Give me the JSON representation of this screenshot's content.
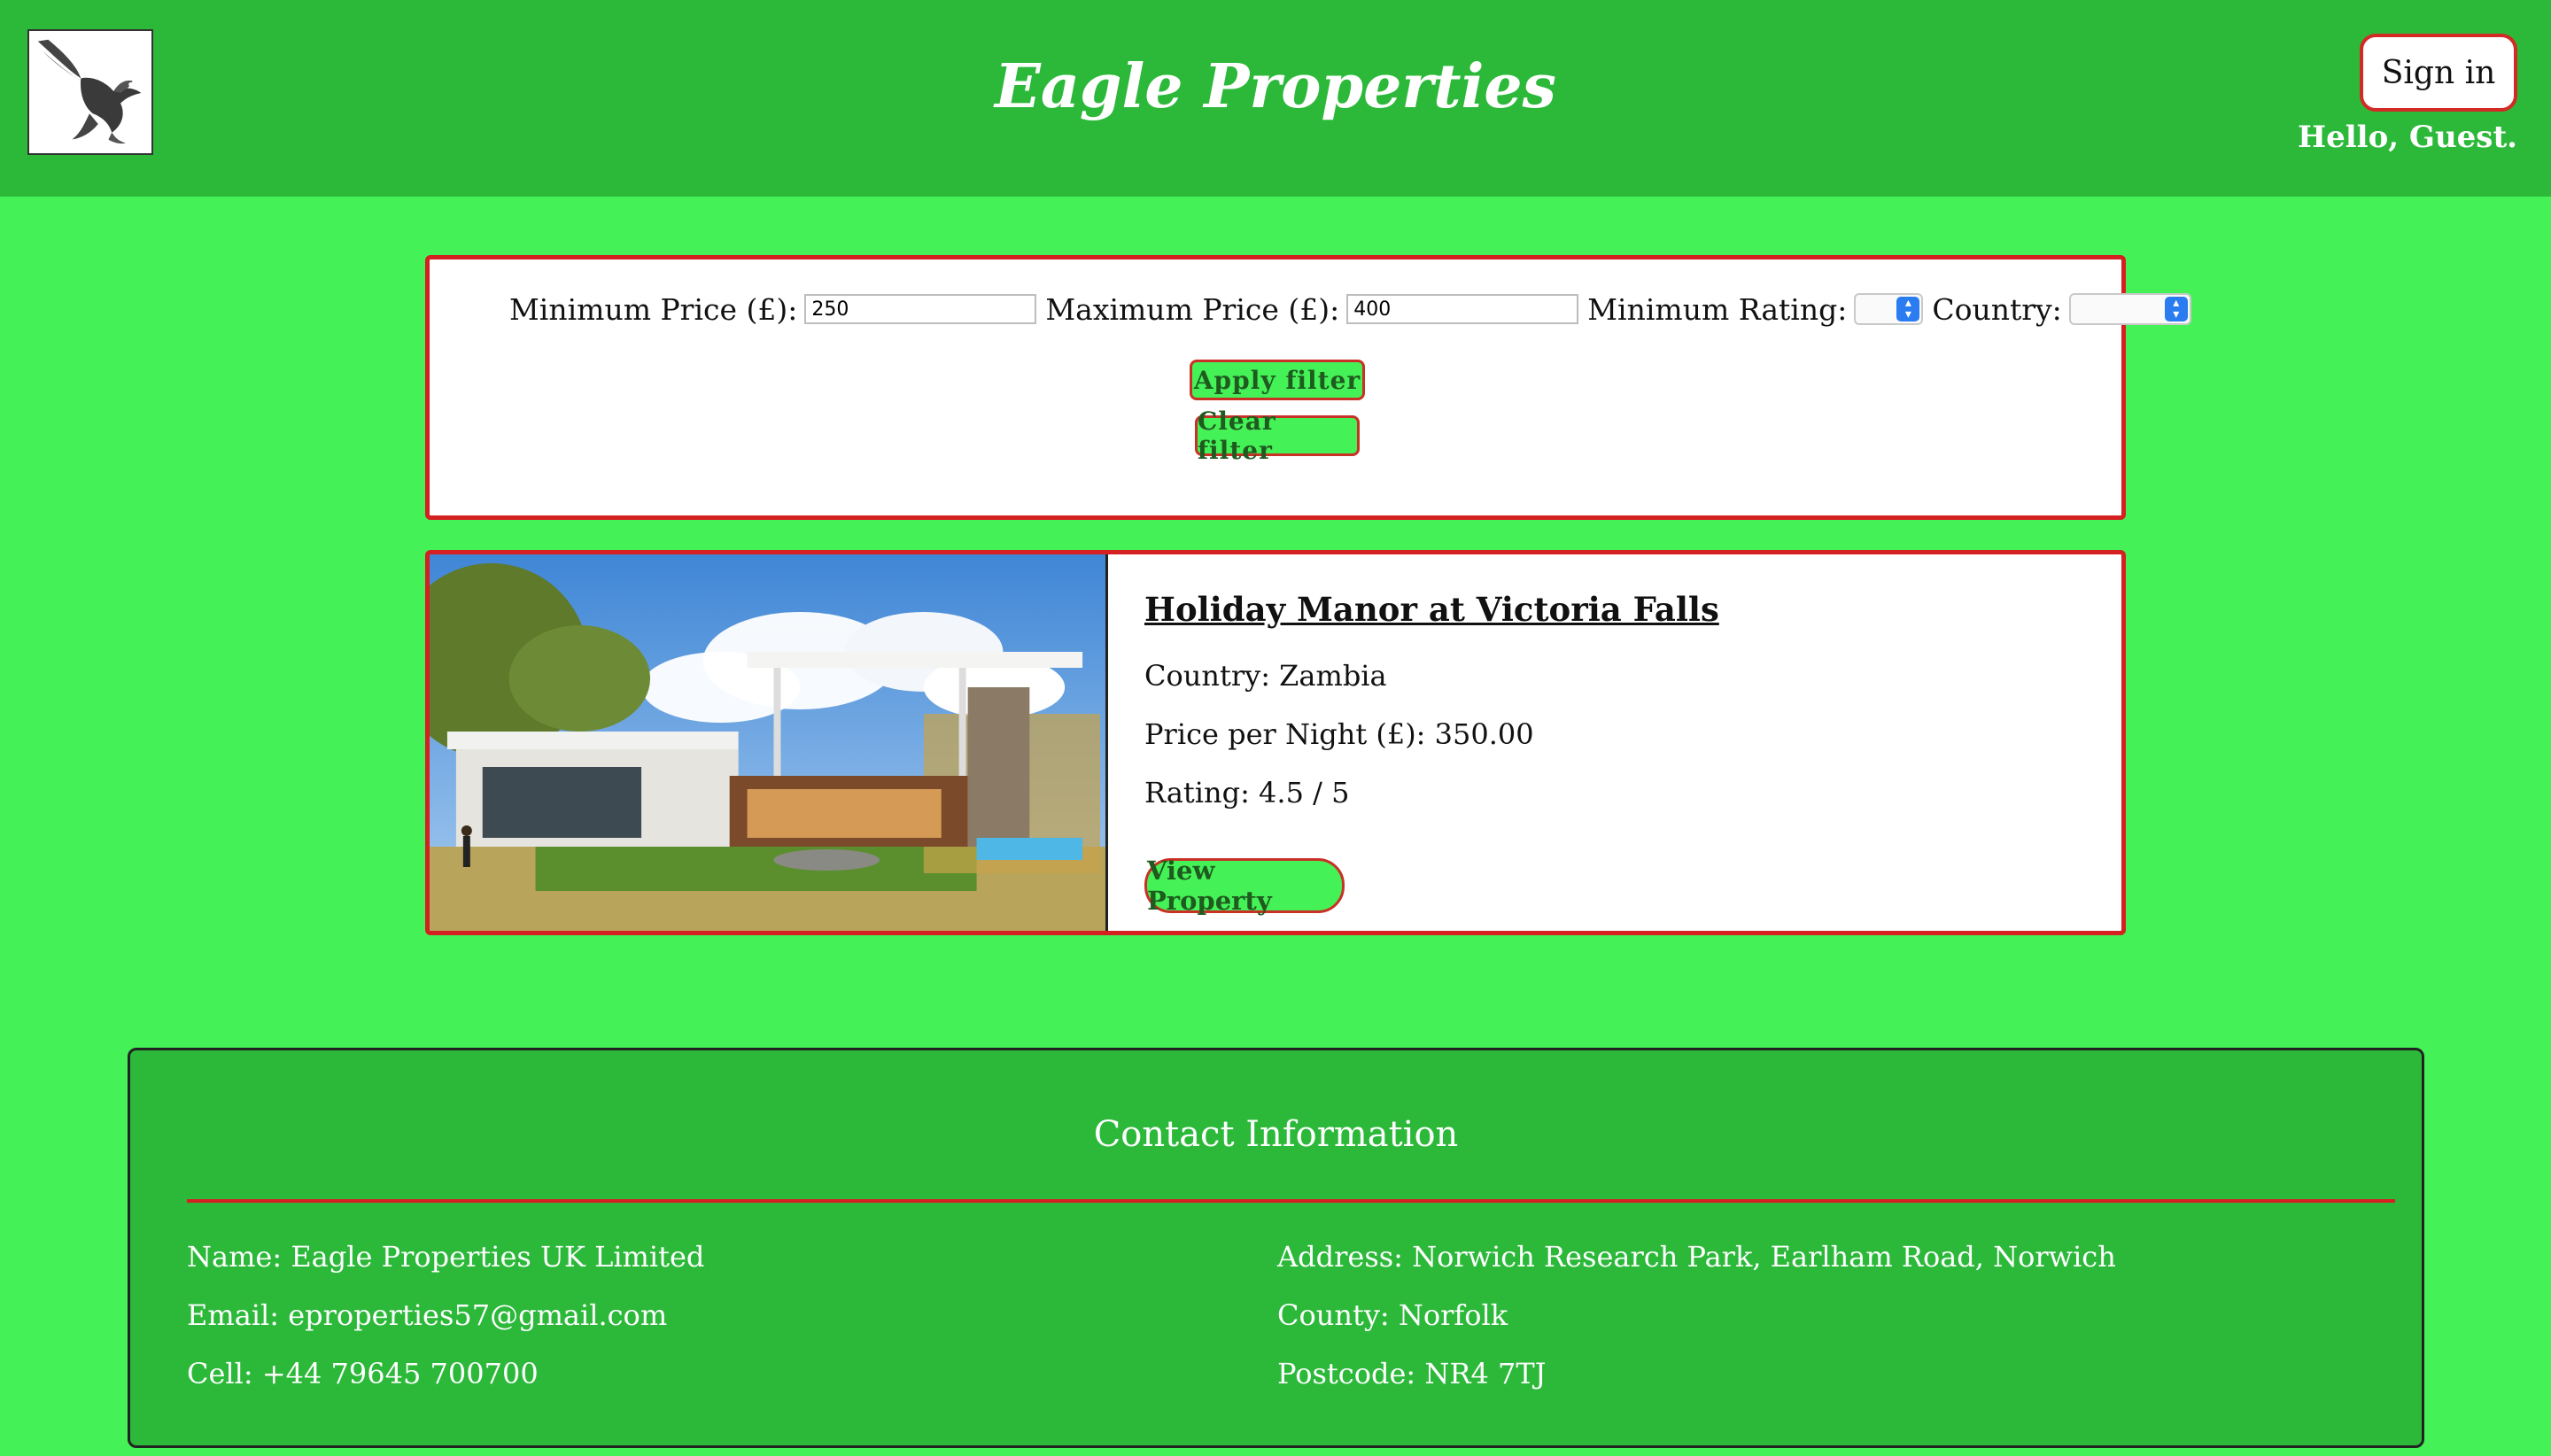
{
  "header": {
    "title": "Eagle Properties",
    "sign_in": "Sign in",
    "greeting": "Hello, Guest."
  },
  "filter": {
    "min_price_label": "Minimum Price (£):",
    "min_price_value": "250",
    "max_price_label": "Maximum Price (£):",
    "max_price_value": "400",
    "min_rating_label": "Minimum Rating:",
    "min_rating_value": "",
    "country_label": "Country:",
    "country_value": "",
    "apply_label": "Apply filter",
    "clear_label": "Clear filter"
  },
  "property": {
    "title": "Holiday Manor at Victoria Falls",
    "country": "Country: Zambia",
    "price": "Price per Night (£): 350.00",
    "rating": "Rating: 4.5 / 5",
    "view_label": "View Property"
  },
  "footer": {
    "title": "Contact Information",
    "name": "Name: Eagle Properties UK Limited",
    "email": "Email: eproperties57@gmail.com",
    "cell": "Cell: +44 79645 700700",
    "address": "Address: Norwich Research Park, Earlham Road, Norwich",
    "county": "County: Norfolk",
    "postcode": "Postcode: NR4 7TJ"
  },
  "colors": {
    "page_bg": "#44f257",
    "header_bg": "#2cb93a",
    "accent_border": "#d42020"
  }
}
